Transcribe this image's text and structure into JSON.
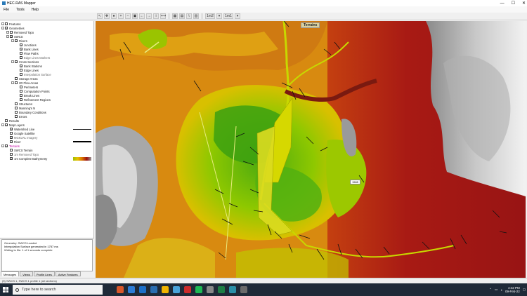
{
  "window": {
    "title": "HEC-RAS Mapper",
    "minimize": "—",
    "maximize": "☐",
    "close": "✕"
  },
  "menu": [
    "File",
    "Tools",
    "Help"
  ],
  "toolbar": {
    "zoom_field": "1m2",
    "scale_field": "1m1"
  },
  "tree": [
    {
      "indent": 0,
      "expander": "-",
      "check": "",
      "label": "Features",
      "style": ""
    },
    {
      "indent": 0,
      "expander": "-",
      "check": "✓",
      "label": "Geometries",
      "style": ""
    },
    {
      "indent": 1,
      "expander": "+",
      "check": "",
      "label": "Removed Topo",
      "style": ""
    },
    {
      "indent": 1,
      "expander": "-",
      "check": "✓",
      "label": "SWCS",
      "style": ""
    },
    {
      "indent": 2,
      "expander": "-",
      "check": "✓",
      "label": "Rivers",
      "style": ""
    },
    {
      "indent": 3,
      "expander": "",
      "check": "✓",
      "label": "Junctions",
      "style": ""
    },
    {
      "indent": 3,
      "expander": "",
      "check": "✓",
      "label": "Bank Lines",
      "style": ""
    },
    {
      "indent": 3,
      "expander": "",
      "check": "",
      "label": "Flow Paths",
      "style": ""
    },
    {
      "indent": 3,
      "expander": "",
      "check": "",
      "label": "Edge Lines Markers",
      "style": "dim"
    },
    {
      "indent": 2,
      "expander": "-",
      "check": "✓",
      "label": "Cross Sections",
      "style": ""
    },
    {
      "indent": 3,
      "expander": "",
      "check": "✓",
      "label": "Bank Stations",
      "style": ""
    },
    {
      "indent": 3,
      "expander": "",
      "check": "",
      "label": "Edge Lines",
      "style": ""
    },
    {
      "indent": 3,
      "expander": "",
      "check": "",
      "label": "Interpolation Surface",
      "style": "dim"
    },
    {
      "indent": 2,
      "expander": "",
      "check": "",
      "label": "Storage Areas",
      "style": ""
    },
    {
      "indent": 2,
      "expander": "-",
      "check": "",
      "label": "2D Flow Areas",
      "style": ""
    },
    {
      "indent": 3,
      "expander": "",
      "check": "",
      "label": "Perimeters",
      "style": ""
    },
    {
      "indent": 3,
      "expander": "",
      "check": "",
      "label": "Computation Points",
      "style": ""
    },
    {
      "indent": 3,
      "expander": "",
      "check": "",
      "label": "Break Lines",
      "style": ""
    },
    {
      "indent": 3,
      "expander": "",
      "check": "",
      "label": "Refinement Regions",
      "style": ""
    },
    {
      "indent": 2,
      "expander": "",
      "check": "",
      "label": "Structures",
      "style": ""
    },
    {
      "indent": 2,
      "expander": "",
      "check": "",
      "label": "Manning's N",
      "style": ""
    },
    {
      "indent": 2,
      "expander": "",
      "check": "",
      "label": "Boundary Conditions",
      "style": ""
    },
    {
      "indent": 2,
      "expander": "",
      "check": "",
      "label": "Errors",
      "style": ""
    },
    {
      "indent": 0,
      "expander": "",
      "check": "",
      "label": "Results",
      "style": ""
    },
    {
      "indent": 0,
      "expander": "-",
      "check": "✓",
      "label": "Map Layers",
      "style": ""
    },
    {
      "indent": 1,
      "expander": "",
      "check": "✓",
      "label": "Watershed Line",
      "style": "",
      "legend": "line"
    },
    {
      "indent": 1,
      "expander": "",
      "check": "",
      "label": "Google Satellite",
      "style": ""
    },
    {
      "indent": 1,
      "expander": "",
      "check": "✓",
      "label": "MGKLRL Imagery",
      "style": "dim"
    },
    {
      "indent": 1,
      "expander": "",
      "check": "✓",
      "label": "River",
      "style": "",
      "legend": "thick"
    },
    {
      "indent": 0,
      "expander": "-",
      "check": "✓",
      "label": "Terrains",
      "style": "pink"
    },
    {
      "indent": 1,
      "expander": "",
      "check": "",
      "label": "SWCS Terrain",
      "style": ""
    },
    {
      "indent": 1,
      "expander": "",
      "check": "",
      "label": "1m Removed Topo",
      "style": "dim"
    },
    {
      "indent": 1,
      "expander": "",
      "check": "✓",
      "label": "1m Complete Bathymetry",
      "style": "",
      "legend": "ramp"
    }
  ],
  "messages": [
    {
      "text": "Geometry: SWCS Loaded",
      "err": false
    },
    {
      "text": "Interpolation Surface generated in 1757 ms",
      "err": true
    },
    {
      "text": "Writing to file: 1 of 1 seconds complete",
      "err": false
    }
  ],
  "tabs": [
    "Messages",
    "Views",
    "Profile Lines",
    "Active Features"
  ],
  "status_text": "(ft) SWCS 1, SWCS 1 profile 1 (all sections)",
  "map": {
    "terrain_label": "Terrains",
    "tag": "1565"
  },
  "taskbar": {
    "search_placeholder": "Type here to search",
    "time": "4:42 PM",
    "date": "09-Feb-22",
    "app_colors": [
      "#d9572a",
      "#2d7cd6",
      "#1c6fc8",
      "#2a6db0",
      "#f0b400",
      "#4aa3d9",
      "#cc2b2b",
      "#1db954",
      "#888888",
      "#1e7e45",
      "#2a8fa8",
      "#6a6a6a"
    ]
  }
}
